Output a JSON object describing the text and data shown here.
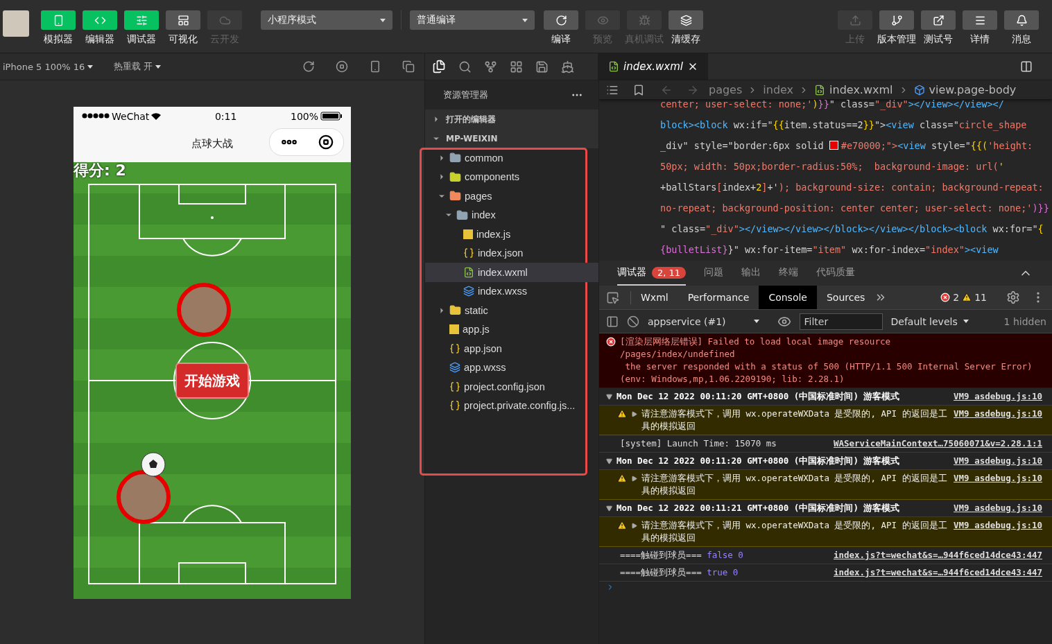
{
  "toolbar": {
    "view_buttons": [
      {
        "label": "模拟器",
        "on": true,
        "disabled": false
      },
      {
        "label": "编辑器",
        "on": true,
        "disabled": false
      },
      {
        "label": "调试器",
        "on": true,
        "disabled": false
      },
      {
        "label": "可视化",
        "on": false,
        "disabled": false
      },
      {
        "label": "云开发",
        "on": false,
        "disabled": true
      }
    ],
    "mode_select": "小程序模式",
    "compile_select": "普通编译",
    "action_buttons": [
      {
        "label": "编译",
        "disabled": false
      },
      {
        "label": "预览",
        "disabled": true
      },
      {
        "label": "真机调试",
        "disabled": true
      },
      {
        "label": "清缓存",
        "disabled": false
      }
    ],
    "right_buttons": [
      {
        "label": "上传",
        "disabled": true
      },
      {
        "label": "版本管理",
        "disabled": false
      },
      {
        "label": "测试号",
        "disabled": false
      },
      {
        "label": "详情",
        "disabled": false
      },
      {
        "label": "消息",
        "disabled": false
      }
    ]
  },
  "simulator_bar": {
    "device": "iPhone 5 100% 16",
    "hot_reload": "热重载 开"
  },
  "phone": {
    "carrier": "WeChat",
    "time": "0:11",
    "battery": "100%",
    "title": "点球大战",
    "score": "得分: 2",
    "start_button": "开始游戏"
  },
  "explorer": {
    "title": "资源管理器",
    "sections": [
      {
        "label": "打开的编辑器",
        "expanded": false
      },
      {
        "label": "MP-WEIXIN",
        "expanded": true
      }
    ],
    "tree": [
      {
        "name": "common",
        "kind": "folder",
        "color": "#8fa3b3",
        "expanded": false,
        "selected": false
      },
      {
        "name": "components",
        "kind": "folder",
        "color": "#c7d22a",
        "expanded": false,
        "selected": false
      },
      {
        "name": "pages",
        "kind": "folder",
        "color": "#f08a5d",
        "expanded": true,
        "selected": false,
        "children": [
          {
            "name": "index",
            "kind": "folder",
            "color": "#8fa3b3",
            "expanded": true,
            "selected": false,
            "children": [
              {
                "name": "index.js",
                "kind": "js",
                "selected": false
              },
              {
                "name": "index.json",
                "kind": "json",
                "selected": false
              },
              {
                "name": "index.wxml",
                "kind": "wxml",
                "selected": true
              },
              {
                "name": "index.wxss",
                "kind": "wxss",
                "selected": false
              }
            ]
          }
        ]
      },
      {
        "name": "static",
        "kind": "folder",
        "color": "#e8c33a",
        "expanded": false,
        "selected": false
      },
      {
        "name": "app.js",
        "kind": "js",
        "selected": false
      },
      {
        "name": "app.json",
        "kind": "json",
        "selected": false
      },
      {
        "name": "app.wxss",
        "kind": "wxss",
        "selected": false
      },
      {
        "name": "project.config.json",
        "kind": "json",
        "selected": false
      },
      {
        "name": "project.private.config.js...",
        "kind": "json",
        "selected": false
      }
    ]
  },
  "editor": {
    "tabs": [
      {
        "label": "index.wxml",
        "selected": true
      }
    ],
    "breadcrumb": [
      {
        "label": "pages",
        "kind": "text"
      },
      {
        "label": "index",
        "kind": "text"
      },
      {
        "label": "index.wxml",
        "kind": "wxml"
      },
      {
        "label": "view.page-body",
        "kind": "element"
      }
    ],
    "code_lines": [
      [
        {
          "text": "center; user-select: none;'",
          "kind": "str"
        },
        {
          "text": ")",
          "kind": "b1"
        },
        {
          "text": "}}",
          "kind": "b2"
        },
        {
          "text": "\" class=",
          "kind": "attr"
        },
        {
          "text": "\"_div\"",
          "kind": "str"
        },
        {
          "text": "></view></view></",
          "kind": "tag"
        }
      ],
      [
        {
          "text": "block><block ",
          "kind": "tag"
        },
        {
          "text": "wx:if=\"",
          "kind": "attr"
        },
        {
          "text": "{{",
          "kind": "b1"
        },
        {
          "text": "item.status==2",
          "kind": "attr"
        },
        {
          "text": "}}",
          "kind": "b1"
        },
        {
          "text": "\">",
          "kind": "attr"
        },
        {
          "text": "<view ",
          "kind": "tag"
        },
        {
          "text": "class=\"",
          "kind": "attr"
        },
        {
          "text": "circle_shape",
          "kind": "str"
        }
      ],
      [
        {
          "text": "_div\" style=\"border:6px solid ",
          "kind": "attr"
        },
        {
          "kind": "swatch",
          "color": "#e70000"
        },
        {
          "text": "#e70000;\">",
          "kind": "str"
        },
        {
          "text": "<view ",
          "kind": "tag"
        },
        {
          "text": "style=\"",
          "kind": "attr"
        },
        {
          "text": "{{(",
          "kind": "b1"
        },
        {
          "text": "'height:",
          "kind": "str"
        }
      ],
      [
        {
          "text": "50px; width: 50px;border-radius:50%;  background-image: url(",
          "kind": "str"
        },
        {
          "text": "'",
          "kind": "b1"
        }
      ],
      [
        {
          "text": "+ballStars",
          "kind": "attr"
        },
        {
          "text": "[",
          "kind": "str"
        },
        {
          "text": "index+",
          "kind": "attr"
        },
        {
          "text": "2",
          "kind": "b1"
        },
        {
          "text": "]",
          "kind": "str"
        },
        {
          "text": "+'",
          "kind": "attr"
        },
        {
          "text": "); background-size: contain; background-repeat:",
          "kind": "str"
        }
      ],
      [
        {
          "text": "no-repeat; background-position: center center; user-select: none;'",
          "kind": "str"
        },
        {
          "text": ")}}",
          "kind": "b2"
        }
      ],
      [
        {
          "text": "\" class=",
          "kind": "attr"
        },
        {
          "text": "\"_div\"",
          "kind": "str"
        },
        {
          "text": "></view></view></block></view></block><block ",
          "kind": "tag"
        },
        {
          "text": "wx:for=\"",
          "kind": "attr"
        },
        {
          "text": "{",
          "kind": "b1"
        }
      ],
      [
        {
          "text": "{bulletList}",
          "kind": "b2"
        },
        {
          "text": "}\" wx:for-item=",
          "kind": "attr"
        },
        {
          "text": "\"item\"",
          "kind": "str"
        },
        {
          "text": " wx:for-index=",
          "kind": "attr"
        },
        {
          "text": "\"index\"",
          "kind": "str"
        },
        {
          "text": "><view",
          "kind": "tag"
        }
      ]
    ]
  },
  "devtools": {
    "panel_tabs": [
      {
        "label": "调试器",
        "selected": true,
        "badge": "2, 11"
      },
      {
        "label": "问题",
        "selected": false
      },
      {
        "label": "输出",
        "selected": false
      },
      {
        "label": "终端",
        "selected": false
      },
      {
        "label": "代码质量",
        "selected": false
      }
    ],
    "tabs": [
      {
        "label": "Wxml",
        "selected": false
      },
      {
        "label": "Performance",
        "selected": false
      },
      {
        "label": "Console",
        "selected": true
      },
      {
        "label": "Sources",
        "selected": false
      }
    ],
    "error_count": "2",
    "warning_count": "11",
    "context": "appservice (#1)",
    "filter_placeholder": "Filter",
    "levels": "Default levels",
    "hidden": "1 hidden",
    "messages": [
      {
        "kind": "error",
        "text": "[渲染层网络层错误] Failed to load local image resource\n/pages/index/undefined\n the server responded with a status of 500 (HTTP/1.1 500 Internal Server Error)\n(env: Windows,mp,1.06.2209190; lib: 2.28.1)"
      },
      {
        "kind": "group",
        "text": "Mon Dec 12 2022 00:11:20 GMT+0800 (中国标准时间) 游客模式",
        "source": "VM9 asdebug.js:10"
      },
      {
        "kind": "warn",
        "text": "请注意游客模式下，调用 wx.operateWXData 是受限的, API 的返回是工具的模拟返回",
        "source": "VM9 asdebug.js:10"
      },
      {
        "kind": "log",
        "text": "[system] Launch Time: 15070 ms",
        "source": "WAServiceMainContext…75060071&v=2.28.1:1"
      },
      {
        "kind": "group",
        "text": "Mon Dec 12 2022 00:11:20 GMT+0800 (中国标准时间) 游客模式",
        "source": "VM9 asdebug.js:10"
      },
      {
        "kind": "warn",
        "text": "请注意游客模式下，调用 wx.operateWXData 是受限的, API 的返回是工具的模拟返回",
        "source": "VM9 asdebug.js:10"
      },
      {
        "kind": "group",
        "text": "Mon Dec 12 2022 00:11:21 GMT+0800 (中国标准时间) 游客模式",
        "source": "VM9 asdebug.js:10"
      },
      {
        "kind": "warn",
        "text": "请注意游客模式下，调用 wx.operateWXData 是受限的, API 的返回是工具的模拟返回",
        "source": "VM9 asdebug.js:10"
      },
      {
        "kind": "log",
        "text": "====触碰到球员===",
        "value": "false 0",
        "source": "index.js?t=wechat&s=…944f6ced14dce43:447"
      },
      {
        "kind": "log",
        "text": "====触碰到球员===",
        "value": "true 0",
        "source": "index.js?t=wechat&s=…944f6ced14dce43:447"
      }
    ]
  }
}
